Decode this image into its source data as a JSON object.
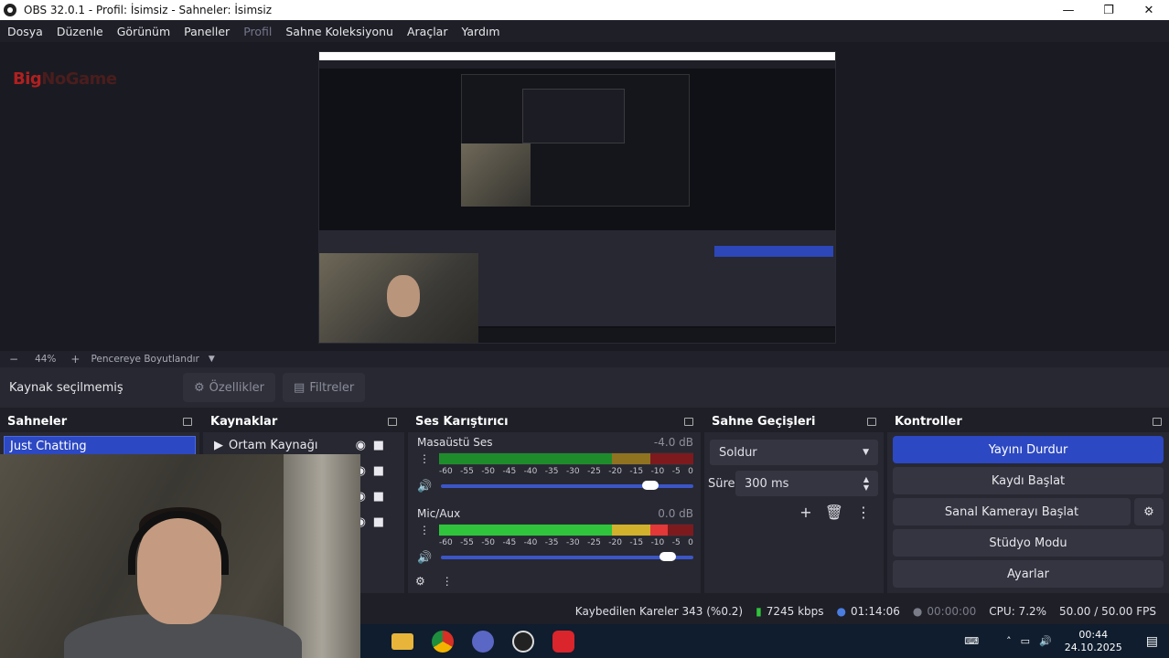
{
  "window": {
    "title": "OBS 32.0.1 - Profil: İsimsiz - Sahneler: İsimsiz",
    "minimize": "—",
    "maximize": "❐",
    "close": "✕"
  },
  "menu": [
    "Dosya",
    "Düzenle",
    "Görünüm",
    "Paneller",
    "Profil",
    "Sahne Koleksiyonu",
    "Araçlar",
    "Yardım"
  ],
  "preview": {
    "watermark_prefix": "Big",
    "watermark_rest": "NoGame"
  },
  "zoom": {
    "minus": "−",
    "level": "44%",
    "plus": "+",
    "fit_label": "Pencereye Boyutlandır"
  },
  "source_toolbar": {
    "no_source": "Kaynak seçilmemiş",
    "properties": "Özellikler",
    "filters": "Filtreler"
  },
  "scenes": {
    "title": "Sahneler",
    "items": [
      "Just Chatting"
    ]
  },
  "sources": {
    "title": "Kaynaklar",
    "items": [
      "Ortam Kaynağı"
    ]
  },
  "mixer": {
    "title": "Ses Karıştırıcı",
    "channels": [
      {
        "name": "Masaüstü Ses",
        "db": "-4.0 dB",
        "level": 0.83
      },
      {
        "name": "Mic/Aux",
        "db": "0.0 dB",
        "level": 0.9
      }
    ],
    "ticks": [
      "-60",
      "-55",
      "-50",
      "-45",
      "-40",
      "-35",
      "-30",
      "-25",
      "-20",
      "-15",
      "-10",
      "-5",
      "0"
    ]
  },
  "transitions": {
    "title": "Sahne Geçişleri",
    "selected": "Soldur",
    "duration_label": "Süre",
    "duration_value": "300 ms"
  },
  "controls": {
    "title": "Kontroller",
    "stop_stream": "Yayını Durdur",
    "start_record": "Kaydı Başlat",
    "virtual_cam": "Sanal Kamerayı Başlat",
    "studio_mode": "Stüdyo Modu",
    "settings": "Ayarlar"
  },
  "status": {
    "dropped": "Kaybedilen Kareler 343 (%0.2)",
    "bitrate": "7245 kbps",
    "stream_time": "01:14:06",
    "record_time": "00:00:00",
    "cpu": "CPU: 7.2%",
    "fps": "50.00 / 50.00 FPS"
  },
  "clock": {
    "time": "00:44",
    "date": "24.10.2025"
  },
  "colors": {
    "accent": "#2c48c2",
    "panel": "#272831",
    "bg": "#1e1f27"
  }
}
